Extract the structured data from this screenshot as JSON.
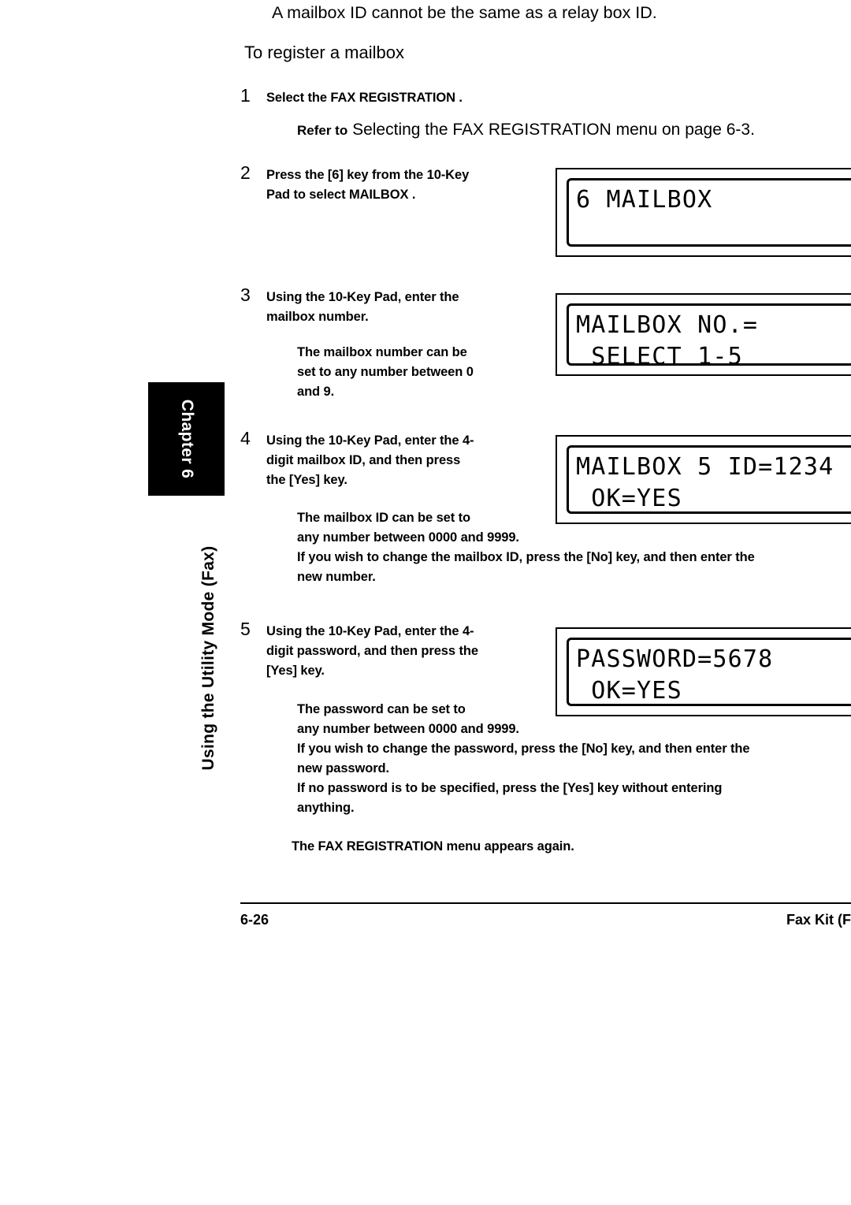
{
  "page": {
    "lead_line": "A mailbox ID cannot be the same as a relay box ID.",
    "section_heading": "To register a mailbox"
  },
  "sidebar": {
    "chapter_label": "Chapter 6",
    "running_head": "Using the Utility Mode (Fax)"
  },
  "steps": [
    {
      "number": "1",
      "lines": [
        "Select the   FAX REGISTRATION         ."
      ],
      "refer_bold": "Refer to",
      "refer_rest": "Selecting the  FAX REGISTRATION  menu  on page 6-3."
    },
    {
      "number": "2",
      "lines": [
        "Press the [6] key from the 10-Key",
        "Pad to select    MAILBOX    ."
      ]
    },
    {
      "number": "3",
      "lines": [
        "Using the 10-Key Pad, enter the",
        "mailbox number."
      ],
      "notes": [
        "The mailbox number can be",
        "set to any number between 0",
        "and 9."
      ]
    },
    {
      "number": "4",
      "lines": [
        "Using the 10-Key Pad, enter the 4-",
        "digit mailbox ID, and then press",
        "the [Yes] key."
      ],
      "notes": [
        "The mailbox ID can be set to",
        "any number between 0000 and 9999.",
        "If you wish to change the mailbox ID, press the [No] key, and then enter the",
        "new number."
      ]
    },
    {
      "number": "5",
      "lines": [
        "Using the 10-Key Pad, enter the 4-",
        "digit password, and then press the",
        "[Yes] key."
      ],
      "notes": [
        "The password can be set to",
        "any number between 0000 and 9999.",
        "If you wish to change the password, press the [No] key, and then enter the",
        "new password.",
        "If no password is to be specified, press the [Yes] key without entering",
        "anything."
      ],
      "tail_note": "The   FAX REGISTRATION          menu appears again."
    }
  ],
  "lcd_panels": [
    {
      "name": "mailbox-menu-display",
      "line1": "6 MAILBOX",
      "line2": ""
    },
    {
      "name": "mailbox-number-display",
      "line1": "MAILBOX NO.=",
      "line2": " SELECT 1-5"
    },
    {
      "name": "mailbox-id-display",
      "line1": "MAILBOX 5 ID=1234",
      "line2": " OK=YES"
    },
    {
      "name": "password-display",
      "line1": "PASSWORD=5678",
      "line2": " OK=YES"
    }
  ],
  "footer": {
    "page_number": "6-26",
    "product": "Fax Kit (F"
  },
  "colors": {
    "ink": "#000000",
    "paper": "#ffffff",
    "tab_background": "#000000",
    "tab_text": "#ffffff"
  }
}
